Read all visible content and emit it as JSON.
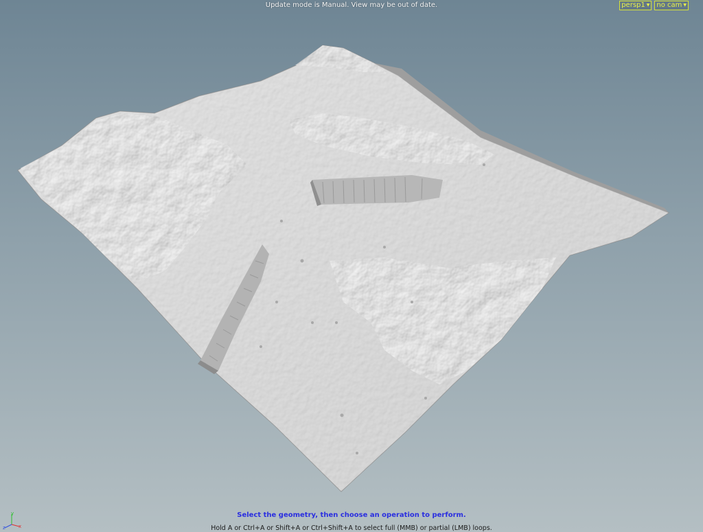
{
  "viewport": {
    "status_message": "Update mode is Manual. View may be out of date.",
    "camera_menu": {
      "label": "persp1",
      "icon": "dropdown-caret"
    },
    "view_camera_menu": {
      "label": "no cam",
      "icon": "dropdown-caret"
    },
    "axis_labels": {
      "x": "x",
      "y": "y",
      "z": "z"
    },
    "colors": {
      "axis_x": "#e03030",
      "axis_y": "#30c030",
      "axis_z": "#3050e0",
      "menu_border": "#d8e23a",
      "prompt_text": "#2a2ee0"
    }
  },
  "prompt": {
    "main": "Select the geometry, then choose an operation to perform.",
    "hint": "Hold A or Ctrl+A or Shift+A or Ctrl+Shift+A to select full (MMB) or partial (LMB) loops."
  }
}
